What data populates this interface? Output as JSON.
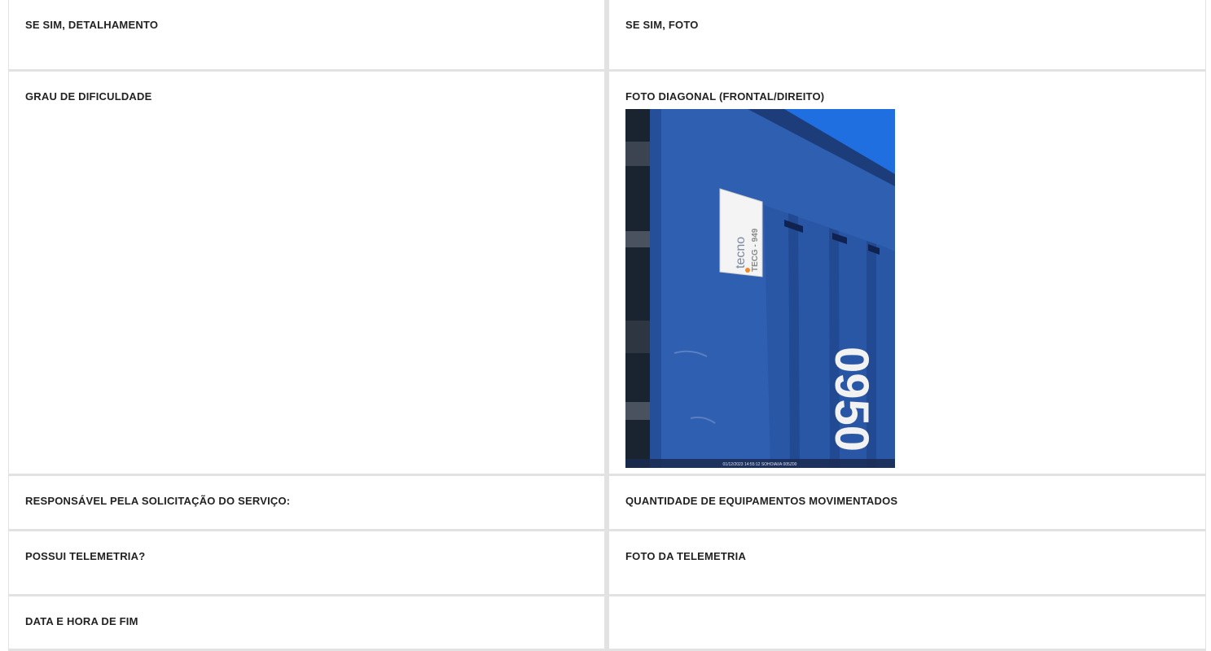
{
  "rows": [
    {
      "left": {
        "label": "SE SIM, DETALHAMENTO"
      },
      "right": {
        "label": "SE SIM, FOTO"
      }
    },
    {
      "left": {
        "label": "GRAU DE DIFICULDADE"
      },
      "right": {
        "label": "FOTO DIAGONAL (FRONTAL/DIREITO)",
        "photo": {
          "plate_brand": "tecno",
          "plate_code": "TECG - 949",
          "painted_text": "0950",
          "timestamp_caption": "01/12/2023 14:55:12  SOHOIAI/A 005Z00"
        }
      }
    },
    {
      "left": {
        "label": "RESPONSÁVEL PELA SOLICITAÇÃO DO SERVIÇO:"
      },
      "right": {
        "label": "QUANTIDADE DE EQUIPAMENTOS MOVIMENTADOS"
      }
    },
    {
      "left": {
        "label": "POSSUI TELEMETRIA?"
      },
      "right": {
        "label": "FOTO DA TELEMETRIA"
      }
    },
    {
      "left": {
        "label": "DATA E HORA DE FIM"
      },
      "right": {
        "label": ""
      }
    }
  ],
  "colors": {
    "border": "#e2e2e2",
    "label_text": "#222222",
    "container_blue": "#2f5fb0",
    "sky_blue": "#1f6fe0"
  }
}
